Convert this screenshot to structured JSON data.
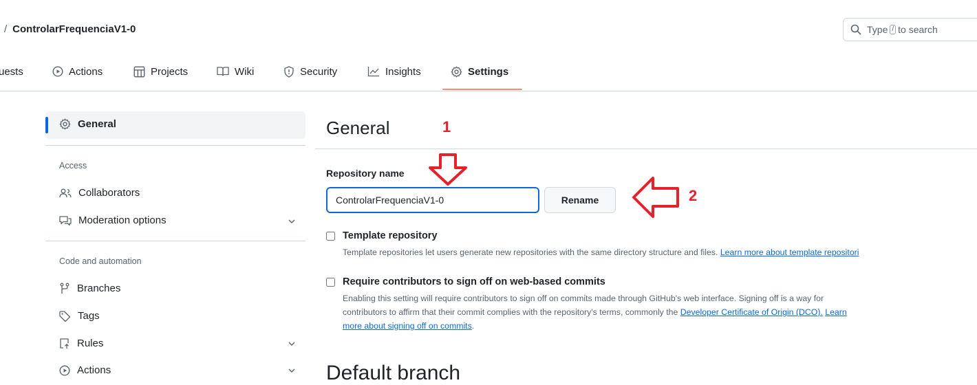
{
  "header": {
    "separator": "/",
    "repo_name": "ControlarFrequenciaV1-0",
    "search_prefix": "Type",
    "search_key": "/",
    "search_suffix": "to search"
  },
  "tabs": [
    {
      "label": "uests",
      "icon": "none"
    },
    {
      "label": "Actions",
      "icon": "play-icon"
    },
    {
      "label": "Projects",
      "icon": "table-icon"
    },
    {
      "label": "Wiki",
      "icon": "book-icon"
    },
    {
      "label": "Security",
      "icon": "shield-icon"
    },
    {
      "label": "Insights",
      "icon": "graph-icon"
    },
    {
      "label": "Settings",
      "icon": "gear-icon",
      "active": true
    }
  ],
  "sidebar": {
    "general": "General",
    "access_heading": "Access",
    "collaborators": "Collaborators",
    "moderation": "Moderation options",
    "code_heading": "Code and automation",
    "branches": "Branches",
    "tags": "Tags",
    "rules": "Rules",
    "actions": "Actions"
  },
  "main": {
    "title": "General",
    "repo_name_label": "Repository name",
    "repo_name_value": "ControlarFrequenciaV1-0",
    "rename_button": "Rename",
    "template_title": "Template repository",
    "template_desc": "Template repositories let users generate new repositories with the same directory structure and files.",
    "template_link": "Learn more about template repositori",
    "signoff_title": "Require contributors to sign off on web-based commits",
    "signoff_desc_1": "Enabling this setting will require contributors to sign off on commits made through GitHub's web interface. Signing off is a way for",
    "signoff_desc_2": "contributors to affirm that their commit complies with the repository's terms, commonly the",
    "signoff_link_1": "Developer Certificate of Origin (DCO).",
    "signoff_link_2a": "Learn",
    "signoff_link_2b": "more about signing off on commits",
    "signoff_end": ".",
    "next_heading": "Default branch"
  },
  "annotations": {
    "step_1": "1",
    "step_2": "2",
    "color": "#e5212b"
  },
  "colors": {
    "accent": "#0969da",
    "tab_underline": "#fd8c73",
    "border": "#d1d9e0",
    "muted": "#59636e"
  }
}
